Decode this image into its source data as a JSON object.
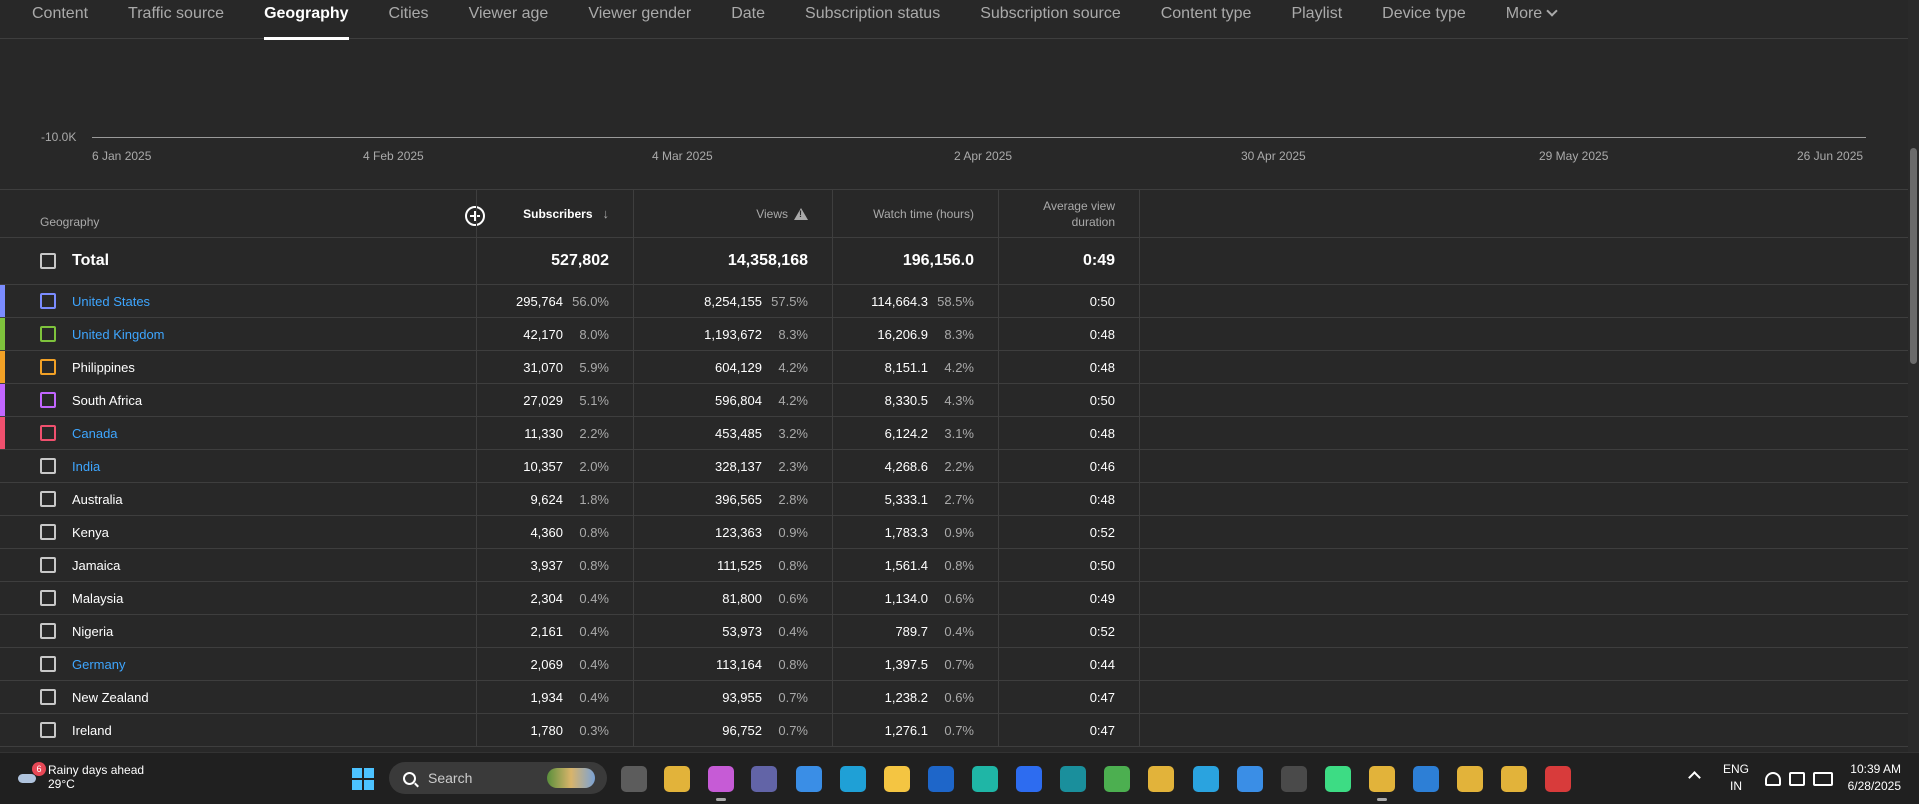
{
  "tabs": [
    {
      "label": "Content",
      "active": false
    },
    {
      "label": "Traffic source",
      "active": false
    },
    {
      "label": "Geography",
      "active": true
    },
    {
      "label": "Cities",
      "active": false
    },
    {
      "label": "Viewer age",
      "active": false
    },
    {
      "label": "Viewer gender",
      "active": false
    },
    {
      "label": "Date",
      "active": false
    },
    {
      "label": "Subscription status",
      "active": false
    },
    {
      "label": "Subscription source",
      "active": false
    },
    {
      "label": "Content type",
      "active": false
    },
    {
      "label": "Playlist",
      "active": false
    },
    {
      "label": "Device type",
      "active": false
    }
  ],
  "more_label": "More",
  "chart": {
    "y_label": "-10.0K",
    "x_labels": [
      "6 Jan 2025",
      "4 Feb 2025",
      "4 Mar 2025",
      "2 Apr 2025",
      "30 Apr 2025",
      "29 May 2025",
      "26 Jun 2025"
    ]
  },
  "table": {
    "headers": {
      "geography": "Geography",
      "subscribers": "Subscribers",
      "views": "Views",
      "watch_time": "Watch time (hours)",
      "avg_view_duration": "Average view duration"
    },
    "total": {
      "label": "Total",
      "subscribers": "527,802",
      "views": "14,358,168",
      "watch_time": "196,156.0",
      "avg": "0:49"
    },
    "rows": [
      {
        "name": "United States",
        "link": true,
        "color": "#7b8cff",
        "subs": "295,764",
        "subs_pct": "56.0%",
        "views": "8,254,155",
        "views_pct": "57.5%",
        "wt": "114,664.3",
        "wt_pct": "58.5%",
        "avg": "0:50"
      },
      {
        "name": "United Kingdom",
        "link": true,
        "color": "#7ec33c",
        "subs": "42,170",
        "subs_pct": "8.0%",
        "views": "1,193,672",
        "views_pct": "8.3%",
        "wt": "16,206.9",
        "wt_pct": "8.3%",
        "avg": "0:48"
      },
      {
        "name": "Philippines",
        "link": false,
        "color": "#f2a126",
        "subs": "31,070",
        "subs_pct": "5.9%",
        "views": "604,129",
        "views_pct": "4.2%",
        "wt": "8,151.1",
        "wt_pct": "4.2%",
        "avg": "0:48"
      },
      {
        "name": "South Africa",
        "link": false,
        "color": "#c266ff",
        "subs": "27,029",
        "subs_pct": "5.1%",
        "views": "596,804",
        "views_pct": "4.2%",
        "wt": "8,330.5",
        "wt_pct": "4.3%",
        "avg": "0:50"
      },
      {
        "name": "Canada",
        "link": true,
        "color": "#f0506e",
        "subs": "11,330",
        "subs_pct": "2.2%",
        "views": "453,485",
        "views_pct": "3.2%",
        "wt": "6,124.2",
        "wt_pct": "3.1%",
        "avg": "0:48"
      },
      {
        "name": "India",
        "link": true,
        "color": "",
        "subs": "10,357",
        "subs_pct": "2.0%",
        "views": "328,137",
        "views_pct": "2.3%",
        "wt": "4,268.6",
        "wt_pct": "2.2%",
        "avg": "0:46"
      },
      {
        "name": "Australia",
        "link": false,
        "color": "",
        "subs": "9,624",
        "subs_pct": "1.8%",
        "views": "396,565",
        "views_pct": "2.8%",
        "wt": "5,333.1",
        "wt_pct": "2.7%",
        "avg": "0:48"
      },
      {
        "name": "Kenya",
        "link": false,
        "color": "",
        "subs": "4,360",
        "subs_pct": "0.8%",
        "views": "123,363",
        "views_pct": "0.9%",
        "wt": "1,783.3",
        "wt_pct": "0.9%",
        "avg": "0:52"
      },
      {
        "name": "Jamaica",
        "link": false,
        "color": "",
        "subs": "3,937",
        "subs_pct": "0.8%",
        "views": "111,525",
        "views_pct": "0.8%",
        "wt": "1,561.4",
        "wt_pct": "0.8%",
        "avg": "0:50"
      },
      {
        "name": "Malaysia",
        "link": false,
        "color": "",
        "subs": "2,304",
        "subs_pct": "0.4%",
        "views": "81,800",
        "views_pct": "0.6%",
        "wt": "1,134.0",
        "wt_pct": "0.6%",
        "avg": "0:49"
      },
      {
        "name": "Nigeria",
        "link": false,
        "color": "",
        "subs": "2,161",
        "subs_pct": "0.4%",
        "views": "53,973",
        "views_pct": "0.4%",
        "wt": "789.7",
        "wt_pct": "0.4%",
        "avg": "0:52"
      },
      {
        "name": "Germany",
        "link": true,
        "color": "",
        "subs": "2,069",
        "subs_pct": "0.4%",
        "views": "113,164",
        "views_pct": "0.8%",
        "wt": "1,397.5",
        "wt_pct": "0.7%",
        "avg": "0:44"
      },
      {
        "name": "New Zealand",
        "link": false,
        "color": "",
        "subs": "1,934",
        "subs_pct": "0.4%",
        "views": "93,955",
        "views_pct": "0.7%",
        "wt": "1,238.2",
        "wt_pct": "0.6%",
        "avg": "0:47"
      },
      {
        "name": "Ireland",
        "link": false,
        "color": "",
        "subs": "1,780",
        "subs_pct": "0.3%",
        "views": "96,752",
        "views_pct": "0.7%",
        "wt": "1,276.1",
        "wt_pct": "0.7%",
        "avg": "0:47"
      }
    ]
  },
  "taskbar": {
    "weather_title": "Rainy days ahead",
    "weather_temp": "29°C",
    "weather_badge": "6",
    "search_label": "Search",
    "lang_1": "ENG",
    "lang_2": "IN",
    "time": "10:39 AM",
    "date": "6/28/2025",
    "app_icons": [
      {
        "name": "task-view-icon",
        "color": "#5c5c5c"
      },
      {
        "name": "chrome-icon",
        "color": "#e2b33a"
      },
      {
        "name": "copilot-icon",
        "color": "#c65bd6"
      },
      {
        "name": "teams-icon",
        "color": "#6264a7"
      },
      {
        "name": "store-icon",
        "color": "#3a8ee6"
      },
      {
        "name": "edge-icon",
        "color": "#1fa0d6"
      },
      {
        "name": "file-explorer-icon",
        "color": "#f4c542"
      },
      {
        "name": "outlook-icon",
        "color": "#1e66c9"
      },
      {
        "name": "pcloud-icon",
        "color": "#1fb6a6"
      },
      {
        "name": "zoom-icon",
        "color": "#2d6cf0"
      },
      {
        "name": "sway-icon",
        "color": "#1a8f9c"
      },
      {
        "name": "network-globe-icon",
        "color": "#4caf50"
      },
      {
        "name": "chrome-profile-r-icon",
        "color": "#e2b33a"
      },
      {
        "name": "telegram-icon",
        "color": "#2aa3df"
      },
      {
        "name": "photos-icon",
        "color": "#3a8ee6"
      },
      {
        "name": "obs-icon",
        "color": "#4a4a4a"
      },
      {
        "name": "android-studio-icon",
        "color": "#3ddc84"
      },
      {
        "name": "chrome-youtube-icon",
        "color": "#e2b33a"
      },
      {
        "name": "remote-desktop-icon",
        "color": "#2d7fd6"
      },
      {
        "name": "chrome-profile-fw-icon",
        "color": "#e2b33a"
      },
      {
        "name": "chrome-profile-n-icon",
        "color": "#e2b33a"
      },
      {
        "name": "snipping-tool-icon",
        "color": "#d83b3b"
      }
    ]
  }
}
